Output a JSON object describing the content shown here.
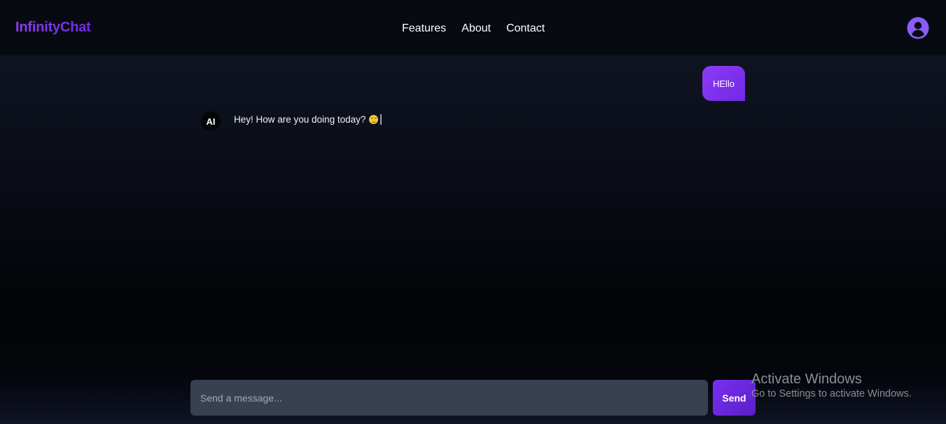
{
  "navbar": {
    "brand": "InfinityChat",
    "links": [
      {
        "label": "Features"
      },
      {
        "label": "About"
      },
      {
        "label": "Contact"
      }
    ],
    "profile_icon": "user-circle-icon"
  },
  "chat": {
    "messages": [
      {
        "role": "user",
        "text": "HEllo"
      },
      {
        "role": "ai",
        "avatar_label": "AI",
        "text": "Hey! How are you doing today?",
        "emoji": "smiling-face-icon"
      }
    ]
  },
  "composer": {
    "placeholder": "Send a message...",
    "value": "",
    "send_label": "Send"
  },
  "os_watermark": {
    "title": "Activate Windows",
    "subtitle": "Go to Settings to activate Windows."
  },
  "colors": {
    "accent": "#7c3aed",
    "background": "#0a0d17",
    "input": "#384152"
  }
}
